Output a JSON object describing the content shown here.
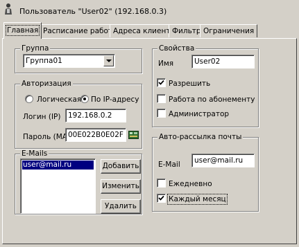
{
  "window": {
    "title": "Пользователь \"User02\" (192.168.0.3)",
    "icon": "user-icon"
  },
  "tabs": [
    {
      "label": "Главная",
      "active": true
    },
    {
      "label": "Расписание работы"
    },
    {
      "label": "Адреса клиента"
    },
    {
      "label": "Фильтр"
    },
    {
      "label": "Ограничения"
    }
  ],
  "group_section": {
    "label": "Группа",
    "selected": "Группа01"
  },
  "auth": {
    "label": "Авторизация",
    "option_logical": "Логическая",
    "option_ip": "По IP-адресу",
    "selected": "ip",
    "login_label": "Логин (IP)",
    "login_value": "192.168.0.2",
    "password_label": "Пароль (MAC)",
    "password_value": "00E022B0E02F",
    "mac_icon": "network-card-icon"
  },
  "emails": {
    "label": "E-Mails",
    "items": [
      "user@mail.ru"
    ],
    "add_label": "Добавить",
    "edit_label": "Изменить",
    "delete_label": "Удалить"
  },
  "properties": {
    "label": "Свойства",
    "name_label": "Имя",
    "name_value": "User02",
    "allow_label": "Разрешить",
    "allow_checked": true,
    "subscription_label": "Работа по абонементу",
    "subscription_checked": false,
    "admin_label": "Администратор",
    "admin_checked": false
  },
  "mailing": {
    "label": "Авто-рассылка почты",
    "email_label": "E-Mail",
    "email_value": "user@mail.ru",
    "daily_label": "Ежедневно",
    "daily_checked": false,
    "monthly_label": "Каждый месяц",
    "monthly_checked": true
  }
}
